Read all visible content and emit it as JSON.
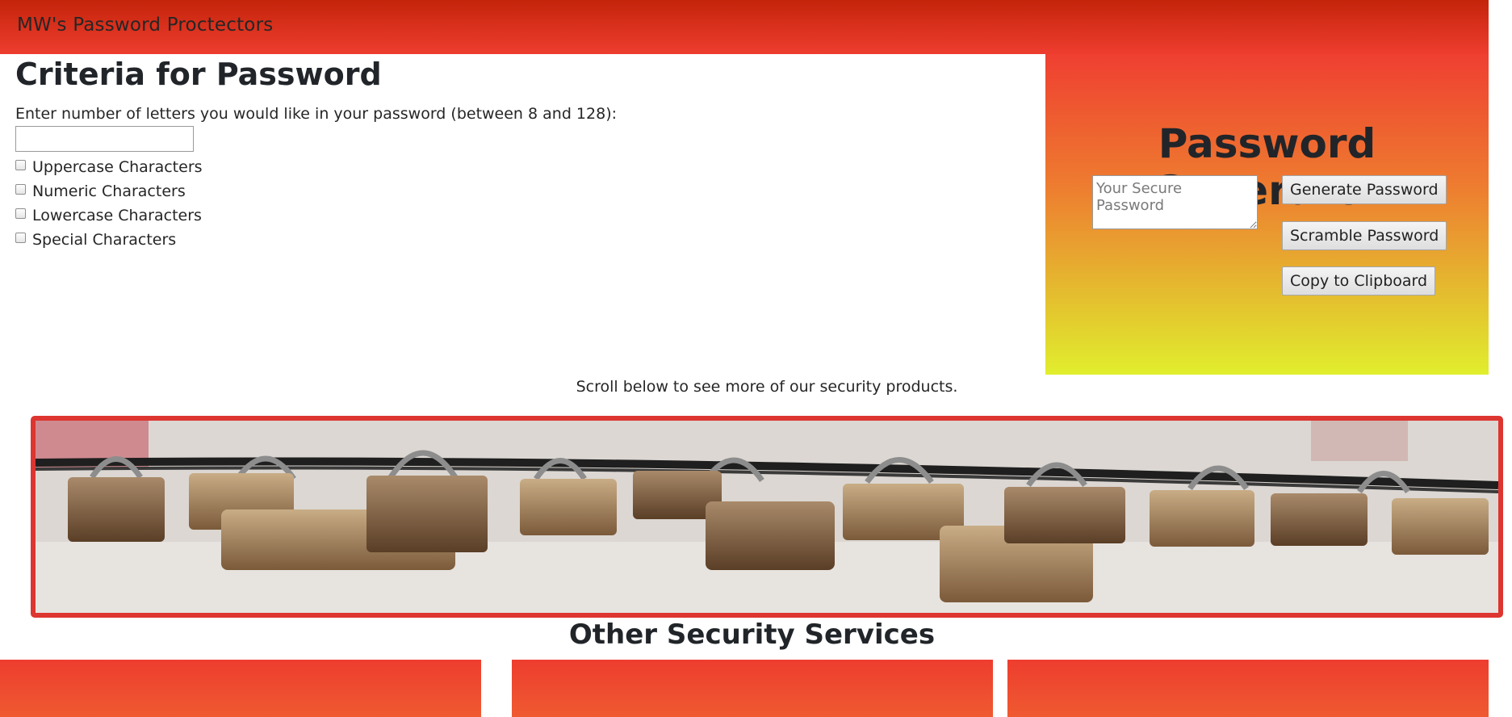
{
  "header": {
    "brand": "MW's Password Proctectors"
  },
  "criteria": {
    "title": "Criteria for Password",
    "instructions": "Enter number of letters you would like in your password (between 8 and 128):",
    "length_value": "",
    "options": [
      {
        "label": "Uppercase Characters",
        "checked": false
      },
      {
        "label": "Numeric Characters",
        "checked": false
      },
      {
        "label": "Lowercase Characters",
        "checked": false
      },
      {
        "label": "Special Characters",
        "checked": false
      }
    ]
  },
  "generator": {
    "title": "Password Generator",
    "output_placeholder": "Your Secure Password",
    "buttons": {
      "generate": "Generate Password",
      "scramble": "Scramble Password",
      "copy": "Copy to Clipboard"
    }
  },
  "scroll_note": "Scroll below to see more of our security products.",
  "banner": {
    "image_icon": "padlocks-on-chain-image"
  },
  "services": {
    "title": "Other Security Services",
    "card_count_visible": 3
  },
  "colors": {
    "header_top": "#c4240a",
    "header_bottom": "#ee3d2f",
    "generator_top": "#ef3f31",
    "generator_bottom": "#e1ee2d",
    "banner_border": "#dd3530"
  }
}
